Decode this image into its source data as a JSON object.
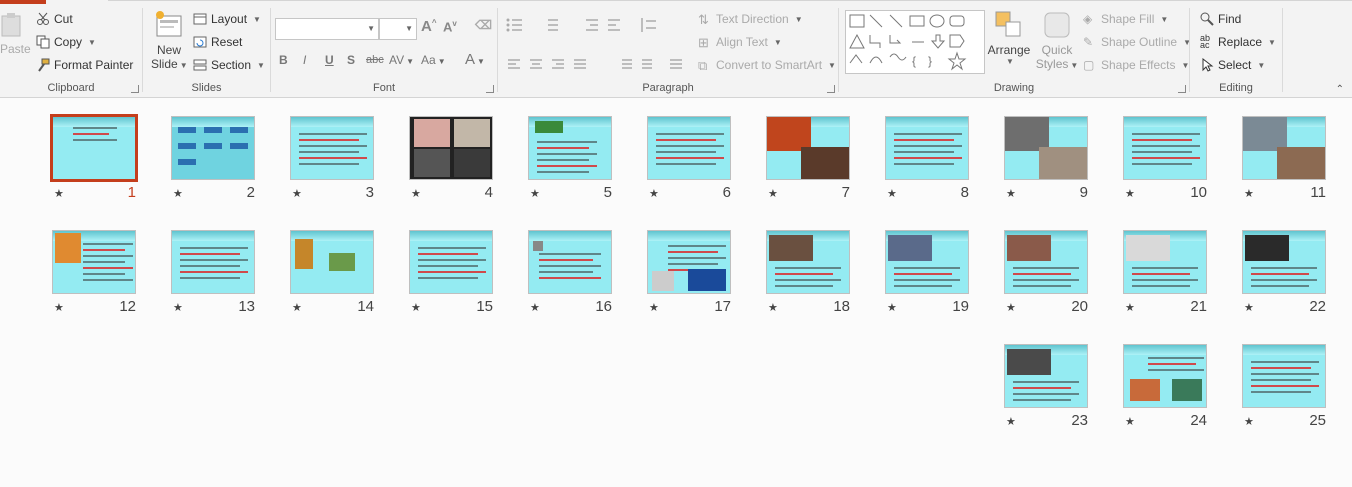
{
  "ribbon": {
    "clipboard": {
      "label": "Clipboard",
      "paste": "Paste",
      "cut": "Cut",
      "copy": "Copy",
      "format_painter": "Format Painter"
    },
    "slides": {
      "label": "Slides",
      "new_slide_line1": "New",
      "new_slide_line2": "Slide",
      "layout": "Layout",
      "reset": "Reset",
      "section": "Section"
    },
    "font": {
      "label": "Font",
      "font_name": "",
      "font_size": "",
      "bold": "B",
      "italic": "I",
      "underline": "U",
      "shadow": "S",
      "strike": "abc",
      "spacing": "AV",
      "case": "Aa",
      "color": "A"
    },
    "paragraph": {
      "label": "Paragraph",
      "text_direction": "Text Direction",
      "align_text": "Align Text",
      "convert_smartart": "Convert to SmartArt"
    },
    "drawing": {
      "label": "Drawing",
      "arrange": "Arrange",
      "quick_styles_1": "Quick",
      "quick_styles_2": "Styles",
      "shape_fill": "Shape Fill",
      "shape_outline": "Shape Outline",
      "shape_effects": "Shape Effects"
    },
    "editing": {
      "label": "Editing",
      "find": "Find",
      "replace": "Replace",
      "select": "Select"
    }
  },
  "slides": [
    {
      "n": "11",
      "kind": "photo",
      "colors": [
        "#7b8a95",
        "#8c6a52"
      ]
    },
    {
      "n": "10",
      "kind": "text"
    },
    {
      "n": "9",
      "kind": "photo",
      "colors": [
        "#6e6e6e",
        "#a09080"
      ]
    },
    {
      "n": "8",
      "kind": "text"
    },
    {
      "n": "7",
      "kind": "photo",
      "colors": [
        "#c0451d",
        "#5a3a2a"
      ]
    },
    {
      "n": "6",
      "kind": "text"
    },
    {
      "n": "5",
      "kind": "green"
    },
    {
      "n": "4",
      "kind": "rocks",
      "colors": [
        "#d8a8a0",
        "#c2b7a8",
        "#555555",
        "#3a3a3a"
      ]
    },
    {
      "n": "3",
      "kind": "text"
    },
    {
      "n": "2",
      "kind": "diagram"
    },
    {
      "n": "1",
      "kind": "title",
      "selected": true
    },
    {
      "n": "22",
      "kind": "photo-left",
      "colors": [
        "#2a2a2a"
      ]
    },
    {
      "n": "21",
      "kind": "photo-left",
      "colors": [
        "#d9d9d9"
      ]
    },
    {
      "n": "20",
      "kind": "photo-left",
      "colors": [
        "#8a5a4a"
      ]
    },
    {
      "n": "19",
      "kind": "photo-left",
      "colors": [
        "#5a6a8a"
      ]
    },
    {
      "n": "18",
      "kind": "photo-left",
      "colors": [
        "#6a5040"
      ]
    },
    {
      "n": "17",
      "kind": "bottom-photos",
      "colors": [
        "#cccccc",
        "#1a4a9a"
      ]
    },
    {
      "n": "16",
      "kind": "icon"
    },
    {
      "n": "15",
      "kind": "text"
    },
    {
      "n": "14",
      "kind": "layers",
      "colors": [
        "#c5862a",
        "#6a9a4a"
      ]
    },
    {
      "n": "13",
      "kind": "text"
    },
    {
      "n": "12",
      "kind": "orange",
      "colors": [
        "#e08a30"
      ]
    },
    {
      "n": "25",
      "kind": "text"
    },
    {
      "n": "24",
      "kind": "gems",
      "colors": [
        "#c86a3a",
        "#3a7a5a"
      ]
    },
    {
      "n": "23",
      "kind": "photo-left",
      "colors": [
        "#4a4a4a"
      ]
    }
  ]
}
